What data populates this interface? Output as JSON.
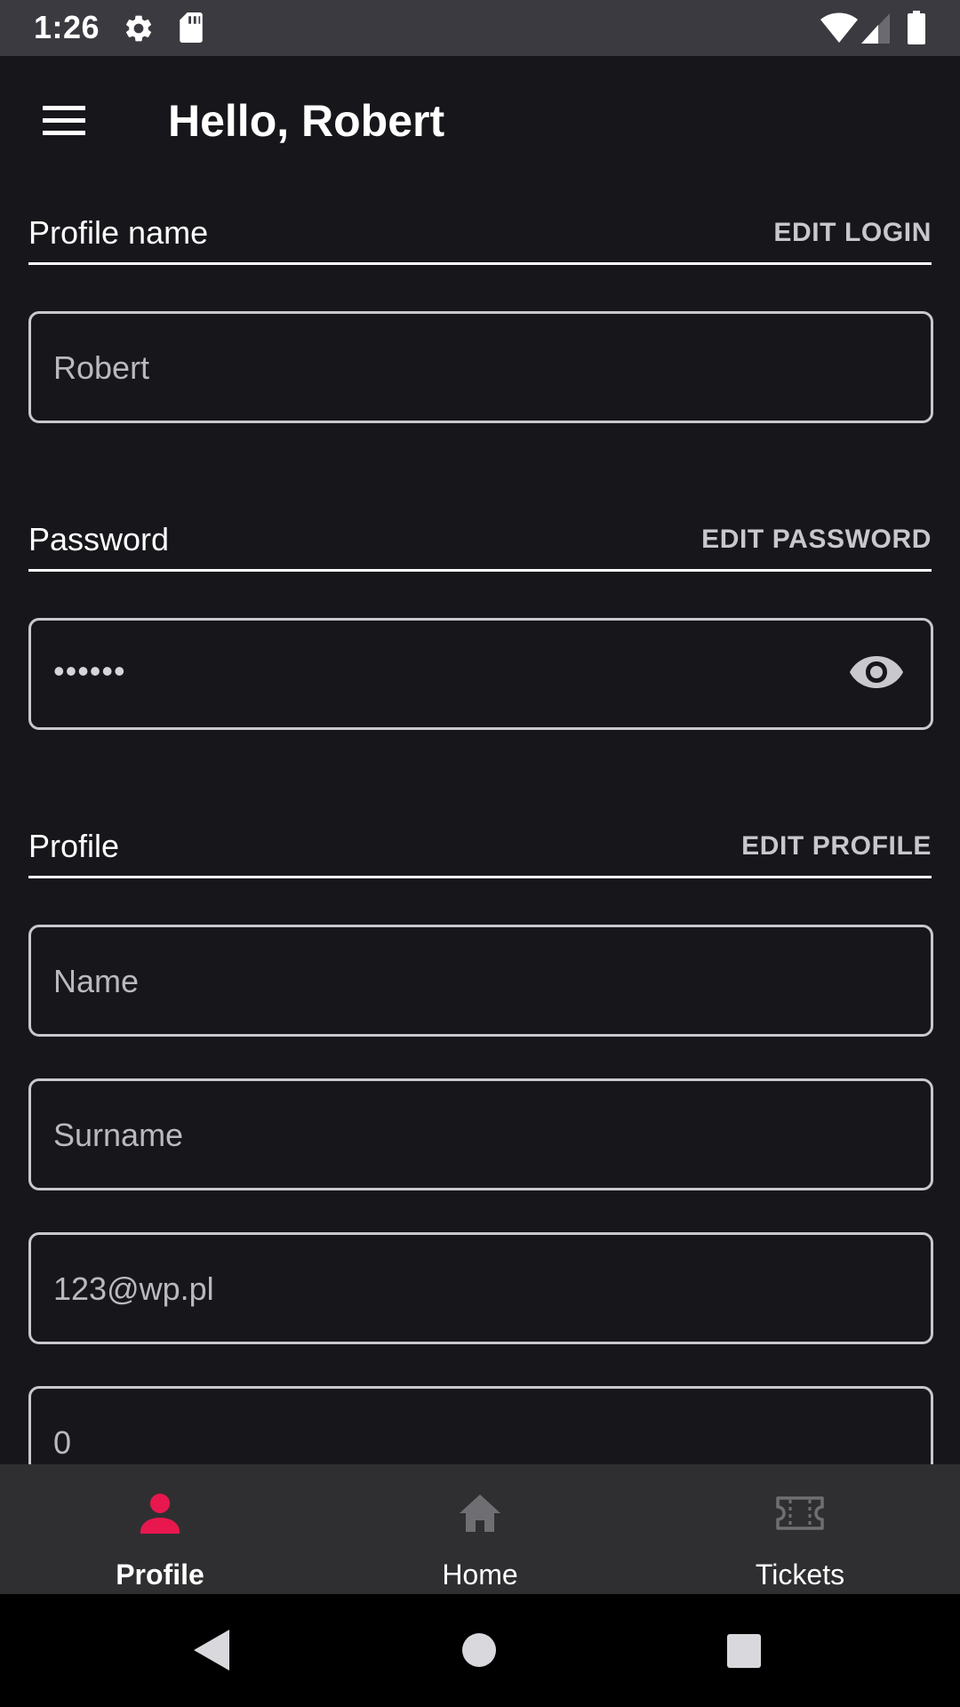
{
  "status_bar": {
    "time": "1:26",
    "icons": [
      "gear-icon",
      "sd-card-icon",
      "wifi-icon",
      "signal-icon",
      "battery-icon"
    ]
  },
  "app_bar": {
    "title": "Hello, Robert",
    "menu_icon": "hamburger-menu-icon"
  },
  "sections": {
    "login": {
      "title": "Profile name",
      "action": "EDIT LOGIN",
      "value": "Robert"
    },
    "password": {
      "title": "Password",
      "action": "EDIT PASSWORD",
      "value": "••••••",
      "toggle_icon": "eye-icon"
    },
    "profile": {
      "title": "Profile",
      "action": "EDIT PROFILE",
      "fields": {
        "name": "Name",
        "surname": "Surname",
        "email": "123@wp.pl",
        "phone": "0"
      }
    }
  },
  "bottom_nav": {
    "items": [
      {
        "label": "Profile",
        "icon": "person-icon",
        "active": true
      },
      {
        "label": "Home",
        "icon": "home-icon",
        "active": false
      },
      {
        "label": "Tickets",
        "icon": "ticket-icon",
        "active": false
      }
    ]
  },
  "colors": {
    "background": "#17161b",
    "accent": "#e8184e",
    "nav_background": "#2f2f31",
    "field_border": "#c9c9cd",
    "inactive_icon": "#6f6f73"
  }
}
